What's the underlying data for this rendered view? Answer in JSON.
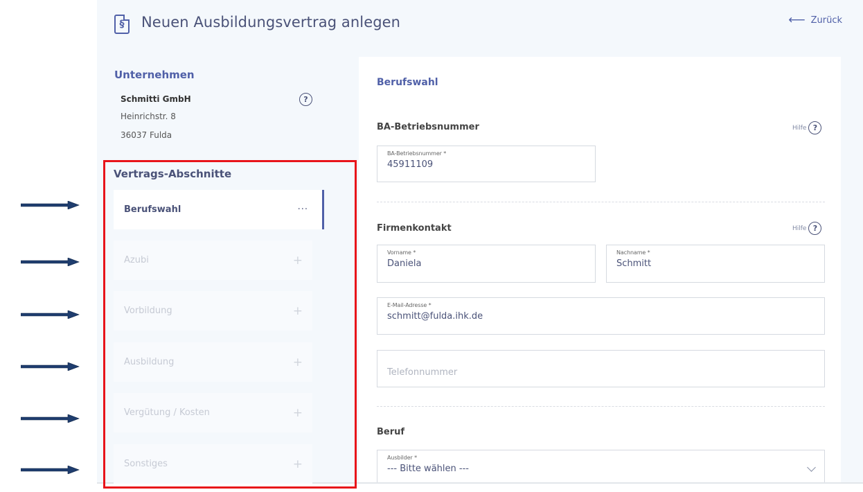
{
  "header": {
    "title": "Neuen Ausbildungsvertrag anlegen",
    "icon_glyph": "§",
    "back_label": "Zurück",
    "back_arrow": "⟵"
  },
  "company": {
    "title": "Unternehmen",
    "name": "Schmitti GmbH",
    "street": "Heinrichstr. 8",
    "city": "36037 Fulda",
    "help_glyph": "?"
  },
  "sections": {
    "title": "Vertrags-Abschnitte",
    "items": [
      {
        "label": "Berufswahl",
        "marker": "···"
      },
      {
        "label": "Azubi",
        "marker": "+"
      },
      {
        "label": "Vorbildung",
        "marker": "+"
      },
      {
        "label": "Ausbildung",
        "marker": "+"
      },
      {
        "label": "Vergütung / Kosten",
        "marker": "+"
      },
      {
        "label": "Sonstiges",
        "marker": "+"
      }
    ]
  },
  "form": {
    "heading": "Berufswahl",
    "hilfe_label": "Hilfe",
    "ba": {
      "group_title": "BA-Betriebsnummer",
      "field_label": "BA-Betriebsnummer *",
      "field_value": "45911109"
    },
    "contact": {
      "group_title": "Firmenkontakt",
      "vorname_label": "Vorname *",
      "vorname_value": "Daniela",
      "nachname_label": "Nachname *",
      "nachname_value": "Schmitt",
      "email_label": "E-Mail-Adresse *",
      "email_value": "schmitt@fulda.ihk.de",
      "phone_placeholder": "Telefonnummer"
    },
    "beruf": {
      "group_title": "Beruf",
      "ausbilder_label": "Ausbilder *",
      "ausbilder_value": "--- Bitte wählen ---"
    }
  },
  "colors": {
    "accent": "#5060a8",
    "annotation_box": "#e8141a",
    "annotation_arrow": "#1f3d6e"
  }
}
